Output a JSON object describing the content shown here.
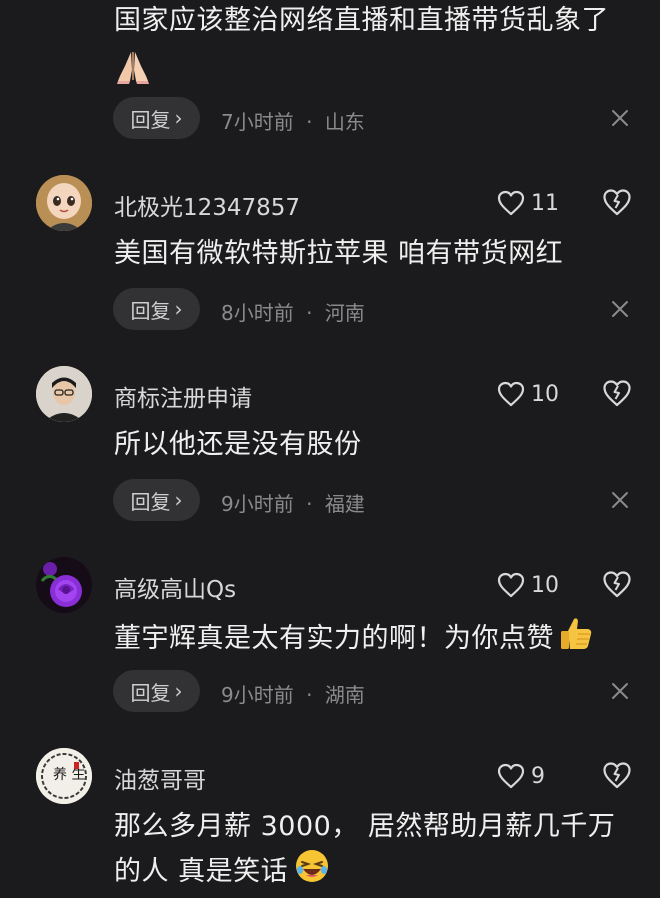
{
  "comments": [
    {
      "text": "国家应该整治网络直播和直播带货乱象了",
      "reply_label": "回复",
      "time": "7小时前",
      "location": "山东",
      "emoji": "pray"
    },
    {
      "username": "北极光12347857",
      "likes": "11",
      "text": "美国有微软特斯拉苹果 咱有带货网红",
      "reply_label": "回复",
      "time": "8小时前",
      "location": "河南"
    },
    {
      "username": "商标注册申请",
      "likes": "10",
      "text": "所以他还是没有股份",
      "reply_label": "回复",
      "time": "9小时前",
      "location": "福建"
    },
    {
      "username": "高级高山Qs",
      "likes": "10",
      "text": "董宇辉真是太有实力的啊！为你点赞",
      "reply_label": "回复",
      "time": "9小时前",
      "location": "湖南",
      "emoji": "thumbs-up"
    },
    {
      "username": "油葱哥哥",
      "likes": "9",
      "text_line1": "那么多月薪 3000， 居然帮助月薪几千万",
      "text_line2": "的人 真是笑话",
      "emoji": "laughing",
      "avatar_text": "养 生"
    }
  ],
  "separator": "·",
  "colors": {
    "background": "#1b1b1d",
    "reply_pill": "#323234",
    "meta_text": "#8a8a8c"
  }
}
